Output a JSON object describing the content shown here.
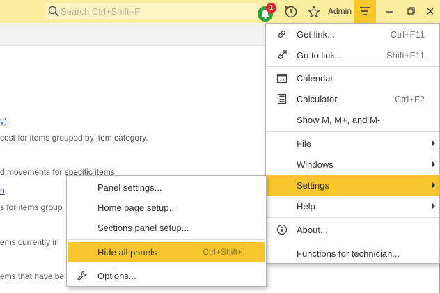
{
  "titlebar": {
    "search_placeholder": "Search Ctrl+Shift+F",
    "notification_count": "1",
    "user": "Admin"
  },
  "content": {
    "lines": [
      {
        "text": "y)",
        "link": true
      },
      {
        "text": " cost for items grouped by item category.",
        "link": false
      },
      {
        "text": "d movements for specific items.",
        "link": false
      },
      {
        "text": "n",
        "link": true
      },
      {
        "text": "s for items group",
        "link": false
      },
      {
        "text": "ems currently in",
        "link": false
      },
      {
        "text": "ems that have be",
        "link": false
      }
    ]
  },
  "main_menu": {
    "items": [
      {
        "label": "Get link...",
        "shortcut": "Ctrl+F11",
        "icon": "link-icon"
      },
      {
        "label": "Go to link...",
        "shortcut": "Shift+F11",
        "icon": "go-to-link-icon"
      },
      {
        "label": "Calendar",
        "shortcut": "",
        "icon": "calendar-icon"
      },
      {
        "label": "Calculator",
        "shortcut": "Ctrl+F2",
        "icon": "calculator-icon"
      },
      {
        "label": "Show M, M+, and M-",
        "shortcut": "",
        "icon": ""
      },
      {
        "label": "File",
        "shortcut": "",
        "icon": "",
        "submenu": true
      },
      {
        "label": "Windows",
        "shortcut": "",
        "icon": "",
        "submenu": true
      },
      {
        "label": "Settings",
        "shortcut": "",
        "icon": "",
        "submenu": true,
        "active": true
      },
      {
        "label": "Help",
        "shortcut": "",
        "icon": "",
        "submenu": true
      },
      {
        "label": "About...",
        "shortcut": "",
        "icon": "info-icon"
      },
      {
        "label": "Functions for technician...",
        "shortcut": "",
        "icon": ""
      }
    ]
  },
  "settings_submenu": {
    "items": [
      {
        "label": "Panel settings...",
        "shortcut": ""
      },
      {
        "label": "Home page setup...",
        "shortcut": ""
      },
      {
        "label": "Sections panel setup...",
        "shortcut": ""
      },
      {
        "label": "Hide all panels",
        "shortcut": "Ctrl+Shift+`",
        "active": true
      },
      {
        "label": "Options...",
        "shortcut": "",
        "icon": "wrench-icon"
      }
    ]
  },
  "colors": {
    "titlebar": "#fbee9e",
    "accent": "#f6c62c",
    "notification_green": "#2f9c3b",
    "badge_red": "#e3262a"
  }
}
